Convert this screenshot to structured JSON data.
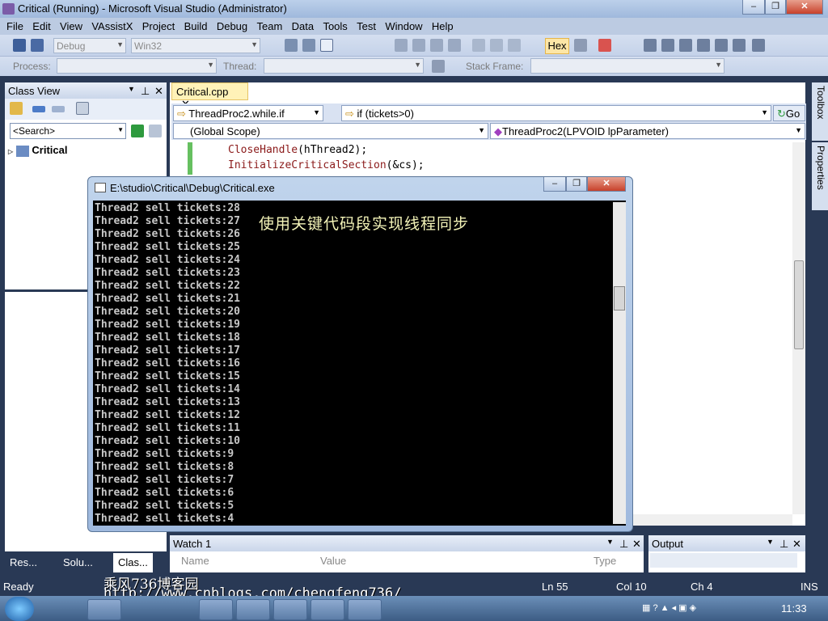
{
  "window": {
    "title": "Critical (Running) - Microsoft Visual Studio (Administrator)",
    "minimize": "–",
    "maximize": "❐",
    "close": "✕"
  },
  "menu": [
    "File",
    "Edit",
    "View",
    "VAssistX",
    "Project",
    "Build",
    "Debug",
    "Team",
    "Data",
    "Tools",
    "Test",
    "Window",
    "Help"
  ],
  "toolbar": {
    "config": "Debug",
    "platform": "Win32",
    "hex": "Hex"
  },
  "toolbar2": {
    "process_label": "Process:",
    "thread_label": "Thread:",
    "stackframe_label": "Stack Frame:"
  },
  "classview": {
    "title": "Class View",
    "search_placeholder": "<Search>",
    "root_item": "Critical",
    "tabs": [
      "Res...",
      "Solu...",
      "Clas..."
    ]
  },
  "editor": {
    "tab": "Critical.cpp",
    "nav_left": "ThreadProc2.while.if",
    "nav_right": "if (tickets>0)",
    "go": "Go",
    "scope": "(Global Scope)",
    "func": "ThreadProc2(LPVOID lpParameter)",
    "code": [
      {
        "fn": "CloseHandle",
        "args": "(hThread2);"
      },
      {
        "fn": "InitializeCriticalSection",
        "args": "(&cs);"
      }
    ]
  },
  "console": {
    "title": "E:\\studio\\Critical\\Debug\\Critical.exe",
    "overlay": "使用关键代码段实现线程同步",
    "lines": [
      "Thread2 sell tickets:28",
      "Thread2 sell tickets:27",
      "Thread2 sell tickets:26",
      "Thread2 sell tickets:25",
      "Thread2 sell tickets:24",
      "Thread2 sell tickets:23",
      "Thread2 sell tickets:22",
      "Thread2 sell tickets:21",
      "Thread2 sell tickets:20",
      "Thread2 sell tickets:19",
      "Thread2 sell tickets:18",
      "Thread2 sell tickets:17",
      "Thread2 sell tickets:16",
      "Thread2 sell tickets:15",
      "Thread2 sell tickets:14",
      "Thread2 sell tickets:13",
      "Thread2 sell tickets:12",
      "Thread2 sell tickets:11",
      "Thread2 sell tickets:10",
      "Thread2 sell tickets:9",
      "Thread2 sell tickets:8",
      "Thread2 sell tickets:7",
      "Thread2 sell tickets:6",
      "Thread2 sell tickets:5",
      "Thread2 sell tickets:4"
    ]
  },
  "watch": {
    "title": "Watch 1",
    "cols": [
      "Name",
      "Value",
      "Type"
    ]
  },
  "output": {
    "title": "Output"
  },
  "side": {
    "toolbox": "Toolbox",
    "properties": "Properties"
  },
  "status": {
    "ready": "Ready",
    "ln": "Ln 55",
    "col": "Col 10",
    "ch": "Ch 4",
    "ins": "INS"
  },
  "watermark": {
    "line1": "乘风736博客园",
    "line2": "http://www.cnblogs.com/chengfeng736/"
  },
  "taskbar": {
    "clock": "11:33"
  },
  "colors": {
    "vs_bg": "#293955",
    "console_bg": "#000000",
    "overlay_text": "#f4f4b8",
    "code_fn": "#8b1a1a"
  }
}
